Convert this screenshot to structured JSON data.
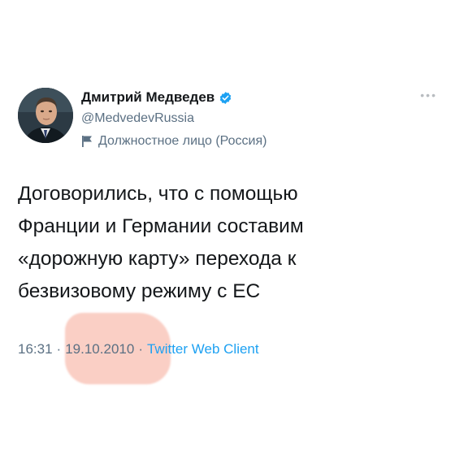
{
  "tweet": {
    "author": {
      "name": "Дмитрий Медведев",
      "handle": "@MedvedevRussia",
      "label": "Должностное лицо (Россия)",
      "verified": true,
      "avatar_icon": "person-avatar"
    },
    "text_lines": [
      "Договорились, что с помощью",
      "Франции и Германии составим",
      "«дорожную карту» перехода к",
      "безвизовому режиму с ЕС"
    ],
    "time": "16:31",
    "separator": "·",
    "date": "19.10.2010",
    "client": "Twitter Web Client",
    "more_icon": "more-horizontal-icon"
  },
  "colors": {
    "text": "#14171a",
    "secondary": "#5b7083",
    "link": "#1da1f2",
    "verified": "#1da1f2",
    "highlight": "#f6a896"
  }
}
